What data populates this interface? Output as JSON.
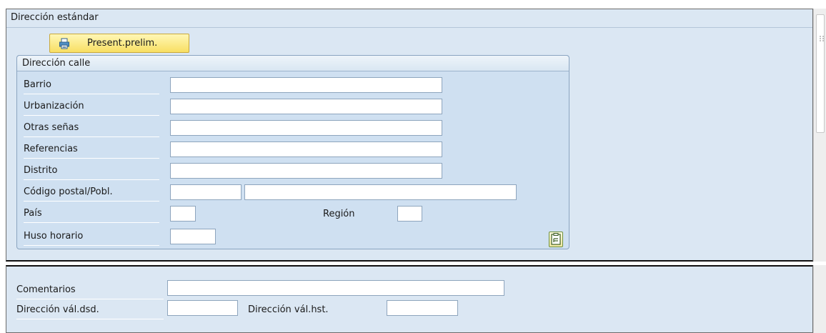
{
  "top_panel": {
    "title": "Dirección estándar",
    "preview_button_label": "Present.prelim."
  },
  "street_address": {
    "title": "Dirección calle",
    "fields": {
      "barrio": {
        "label": "Barrio",
        "value": ""
      },
      "urbanizacion": {
        "label": "Urbanización",
        "value": ""
      },
      "otras_senas": {
        "label": "Otras señas",
        "value": ""
      },
      "referencias": {
        "label": "Referencias",
        "value": ""
      },
      "distrito": {
        "label": "Distrito",
        "value": ""
      },
      "codigo_postal": {
        "label": "Código postal/Pobl.",
        "postal_value": "",
        "city_value": ""
      },
      "pais": {
        "label": "País",
        "value": ""
      },
      "region": {
        "label": "Región",
        "value": ""
      },
      "huso_horario": {
        "label": "Huso horario",
        "value": ""
      }
    }
  },
  "bottom_panel": {
    "comentarios": {
      "label": "Comentarios",
      "value": ""
    },
    "valid_from": {
      "label": "Dirección vál.dsd.",
      "value": ""
    },
    "valid_to": {
      "label": "Dirección vál.hst.",
      "value": ""
    }
  },
  "icons": {
    "preview": "printer-icon",
    "zone": "time-zone-icon",
    "grip": "scroll-grip-icon"
  },
  "colors": {
    "panel_bg": "#dbe7f3",
    "group_bg": "#cfe0f1",
    "button_yellow": "#f8df63"
  }
}
